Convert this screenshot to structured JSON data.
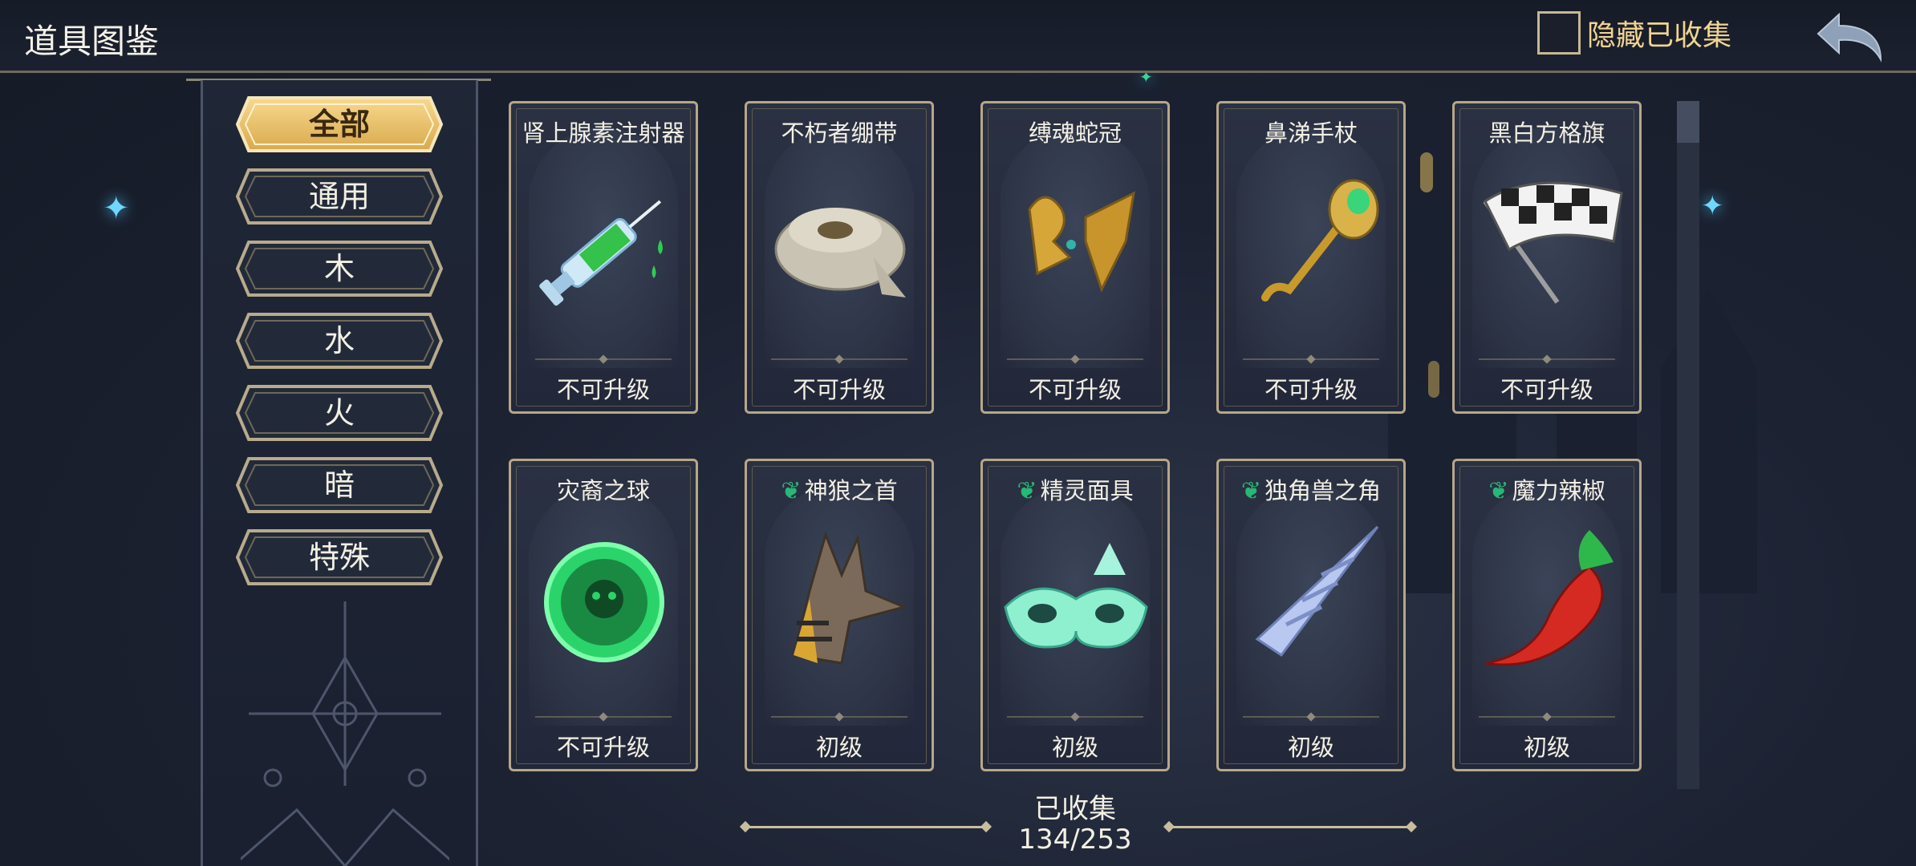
{
  "header": {
    "title": "道具图鉴",
    "hide_collected_label": "隐藏已收集",
    "hide_collected_checked": false
  },
  "categories": [
    {
      "label": "全部",
      "active": true
    },
    {
      "label": "通用",
      "active": false
    },
    {
      "label": "木",
      "active": false
    },
    {
      "label": "水",
      "active": false
    },
    {
      "label": "火",
      "active": false
    },
    {
      "label": "暗",
      "active": false
    },
    {
      "label": "特殊",
      "active": false
    }
  ],
  "items": [
    {
      "name": "肾上腺素注射器",
      "level": "不可升级",
      "icon": "syringe-icon",
      "leaf": false
    },
    {
      "name": "不朽者绷带",
      "level": "不可升级",
      "icon": "bandage-icon",
      "leaf": false
    },
    {
      "name": "缚魂蛇冠",
      "level": "不可升级",
      "icon": "serpent-crown-icon",
      "leaf": false
    },
    {
      "name": "鼻涕手杖",
      "level": "不可升级",
      "icon": "staff-icon",
      "leaf": false
    },
    {
      "name": "黑白方格旗",
      "level": "不可升级",
      "icon": "checkered-flag-icon",
      "leaf": false
    },
    {
      "name": "灾裔之球",
      "level": "不可升级",
      "icon": "orb-icon",
      "leaf": false
    },
    {
      "name": "神狼之首",
      "level": "初级",
      "icon": "jackal-head-icon",
      "leaf": true
    },
    {
      "name": "精灵面具",
      "level": "初级",
      "icon": "mask-icon",
      "leaf": true
    },
    {
      "name": "独角兽之角",
      "level": "初级",
      "icon": "unicorn-horn-icon",
      "leaf": true
    },
    {
      "name": "魔力辣椒",
      "level": "初级",
      "icon": "chili-pepper-icon",
      "leaf": true
    }
  ],
  "footer": {
    "collected_label": "已收集",
    "collected_count": "134/253"
  },
  "colors": {
    "accent_gold": "#f1d48f",
    "card_border": "#b7a788",
    "leaf_green": "#27b776"
  }
}
